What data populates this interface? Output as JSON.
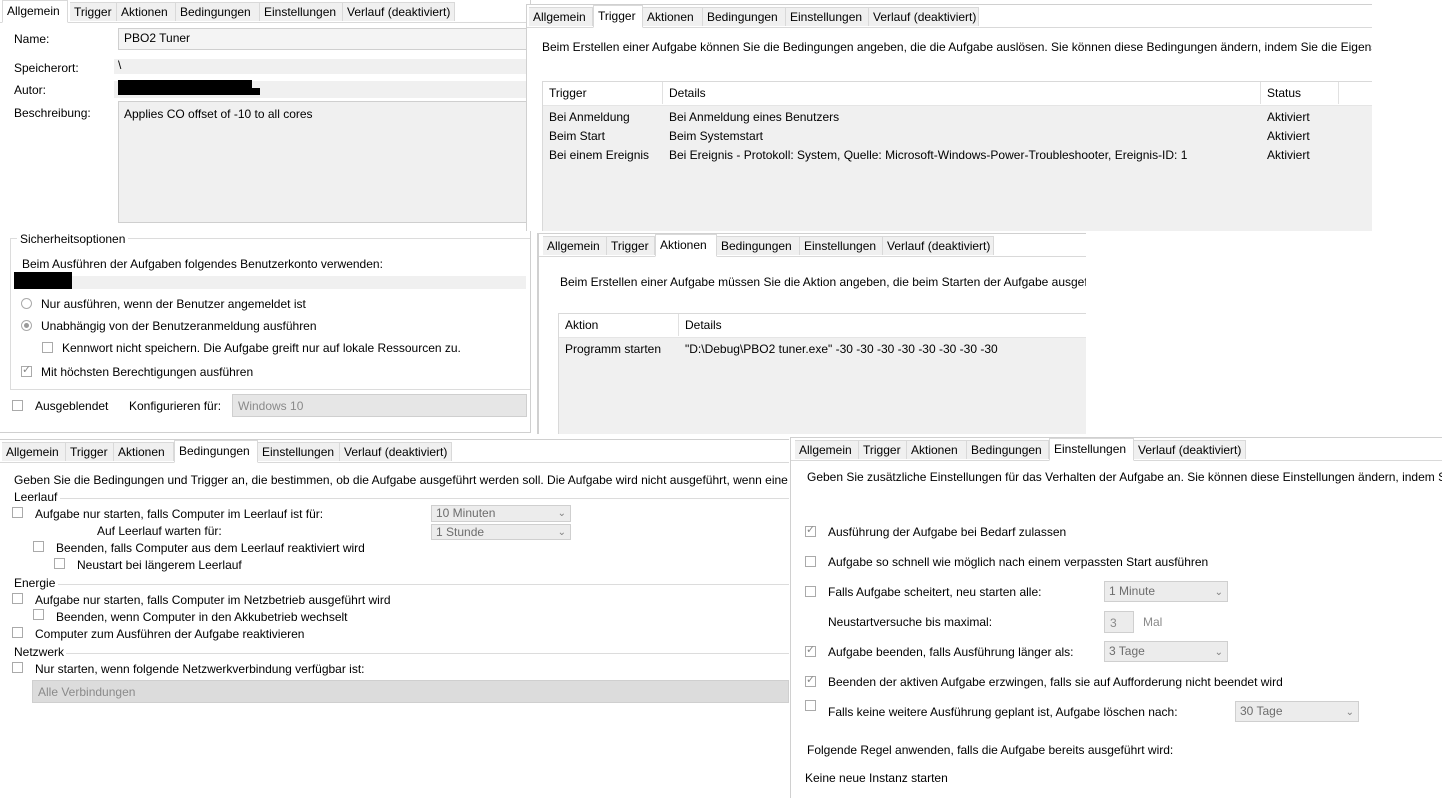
{
  "panel_general": {
    "tabs": [
      "Allgemein",
      "Trigger",
      "Aktionen",
      "Bedingungen",
      "Einstellungen",
      "Verlauf (deaktiviert)"
    ],
    "name_label": "Name:",
    "name_value": "PBO2 Tuner",
    "location_label": "Speicherort:",
    "location_value": "\\",
    "author_label": "Autor:",
    "description_label": "Beschreibung:",
    "description_value": "Applies CO offset of -10 to all cores",
    "security_group": "Sicherheitsoptionen",
    "security_account_text": "Beim Ausführen der Aufgaben folgendes Benutzerkonto verwenden:",
    "radio_logged_on": "Nur ausführen, wenn der Benutzer angemeldet ist",
    "radio_independent": "Unabhängig von der Benutzeranmeldung ausführen",
    "no_password": "Kennwort nicht speichern. Die Aufgabe greift nur auf lokale Ressourcen zu.",
    "highest_privileges": "Mit höchsten Berechtigungen ausführen",
    "hidden": "Ausgeblendet",
    "configure_label": "Konfigurieren für:",
    "configure_value": "Windows 10"
  },
  "panel_trigger": {
    "tabs": [
      "Allgemein",
      "Trigger",
      "Aktionen",
      "Bedingungen",
      "Einstellungen",
      "Verlauf (deaktiviert)"
    ],
    "intro": "Beim Erstellen einer Aufgabe können Sie die Bedingungen angeben, die die Aufgabe auslösen. Sie können diese Bedingungen ändern, indem Sie die Eigenscha",
    "columns": [
      "Trigger",
      "Details",
      "Status"
    ],
    "rows": [
      [
        "Bei Anmeldung",
        "Bei Anmeldung eines Benutzers",
        "Aktiviert"
      ],
      [
        "Beim Start",
        "Beim Systemstart",
        "Aktiviert"
      ],
      [
        "Bei einem Ereignis",
        "Bei Ereignis - Protokoll: System, Quelle: Microsoft-Windows-Power-Troubleshooter, Ereignis-ID: 1",
        "Aktiviert"
      ]
    ]
  },
  "panel_actions": {
    "tabs": [
      "Allgemein",
      "Trigger",
      "Aktionen",
      "Bedingungen",
      "Einstellungen",
      "Verlauf (deaktiviert)"
    ],
    "intro": "Beim Erstellen einer Aufgabe müssen Sie die Aktion angeben, die beim Starten der Aufgabe ausgefü",
    "columns": [
      "Aktion",
      "Details"
    ],
    "rows": [
      [
        "Programm starten",
        "\"D:\\Debug\\PBO2 tuner.exe\" -30 -30 -30 -30 -30 -30 -30 -30"
      ]
    ]
  },
  "panel_conditions": {
    "tabs": [
      "Allgemein",
      "Trigger",
      "Aktionen",
      "Bedingungen",
      "Einstellungen",
      "Verlauf (deaktiviert)"
    ],
    "intro": "Geben Sie die Bedingungen und Trigger an, die bestimmen, ob die Aufgabe ausgeführt werden soll. Die Aufgabe wird nicht ausgeführt, wenn eine c",
    "idle_group": "Leerlauf",
    "idle_start": "Aufgabe nur starten, falls Computer im Leerlauf ist für:",
    "idle_start_value": "10 Minuten",
    "idle_wait": "Auf Leerlauf warten für:",
    "idle_wait_value": "1 Stunde",
    "idle_stop": "Beenden, falls Computer aus dem Leerlauf reaktiviert wird",
    "idle_restart": "Neustart bei längerem Leerlauf",
    "power_group": "Energie",
    "power_ac": "Aufgabe nur starten, falls Computer im Netzbetrieb ausgeführt wird",
    "power_battery": "Beenden, wenn Computer in den Akkubetrieb wechselt",
    "power_wake": "Computer zum Ausführen der Aufgabe reaktivieren",
    "network_group": "Netzwerk",
    "network_only": "Nur starten, wenn folgende Netzwerkverbindung verfügbar ist:",
    "network_value": "Alle Verbindungen"
  },
  "panel_settings": {
    "tabs": [
      "Allgemein",
      "Trigger",
      "Aktionen",
      "Bedingungen",
      "Einstellungen",
      "Verlauf (deaktiviert)"
    ],
    "intro": "Geben Sie zusätzliche Einstellungen für das Verhalten der Aufgabe an. Sie können diese Einstellungen ändern, indem Sie c",
    "allow_on_demand": "Ausführung der Aufgabe bei Bedarf zulassen",
    "run_missed": "Aufgabe so schnell wie möglich nach einem verpassten Start ausführen",
    "restart_on_fail": "Falls Aufgabe scheitert, neu starten alle:",
    "restart_interval": "1 Minute",
    "restart_attempts_label": "Neustartversuche bis maximal:",
    "restart_attempts_value": "3",
    "restart_attempts_unit": "Mal",
    "stop_if_longer": "Aufgabe beenden, falls Ausführung länger als:",
    "stop_if_longer_value": "3 Tage",
    "force_stop": "Beenden der aktiven Aufgabe erzwingen, falls sie auf Aufforderung nicht beendet wird",
    "delete_after": "Falls keine weitere Ausführung geplant ist, Aufgabe löschen nach:",
    "delete_after_value": "30 Tage",
    "rule_label": "Folgende Regel anwenden, falls die Aufgabe bereits ausgeführt wird:",
    "rule_value": "Keine neue Instanz starten"
  }
}
